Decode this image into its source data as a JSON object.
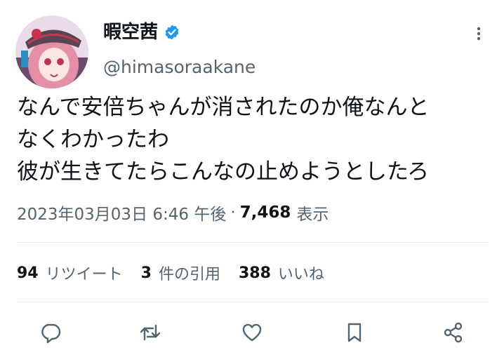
{
  "tweet": {
    "display_name": "暇空茜",
    "verified_icon": "verified-badge-icon",
    "handle": "@himasoraakane",
    "text_lines": [
      "なんで安倍ちゃんが消されたのか俺なんと",
      "なくわかったわ",
      "彼が生きてたらこんなの止めようとしたろ"
    ],
    "timestamp": "2023年03月03日 6:46 午後",
    "separator": "·",
    "views_count": "7,468",
    "views_label": "表示"
  },
  "stats": {
    "retweets_count": "94",
    "retweets_label": "リツイート",
    "quotes_count": "3",
    "quotes_label": "件の引用",
    "likes_count": "388",
    "likes_label": "いいね"
  },
  "actions": {
    "reply_icon": "reply-icon",
    "retweet_icon": "retweet-icon",
    "like_icon": "heart-icon",
    "bookmark_icon": "bookmark-icon",
    "share_icon": "share-icon"
  },
  "colors": {
    "text_primary": "#0f1419",
    "text_secondary": "#536471",
    "verified_blue": "#1d9bf0",
    "divider": "#e7eaed"
  }
}
